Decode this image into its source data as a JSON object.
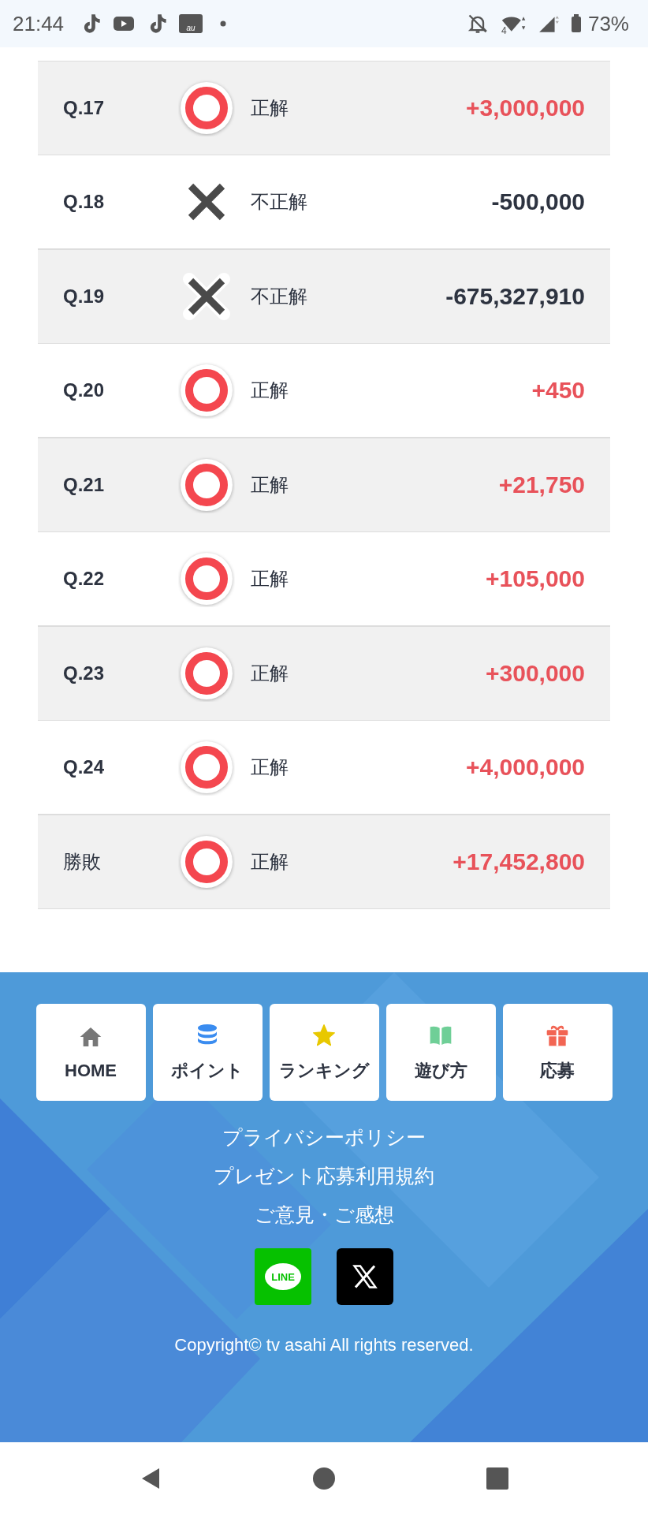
{
  "status_bar": {
    "time": "21:44",
    "mail_badge": "au",
    "network": "4",
    "battery": "73%"
  },
  "results": [
    {
      "kind": "question",
      "label": "Q.17",
      "correct": true,
      "verdict": "正解",
      "amount": "+3,000,000"
    },
    {
      "kind": "question",
      "label": "Q.18",
      "correct": false,
      "verdict": "不正解",
      "amount": "-500,000"
    },
    {
      "kind": "question",
      "label": "Q.19",
      "correct": false,
      "verdict": "不正解",
      "amount": "-675,327,910"
    },
    {
      "kind": "question",
      "label": "Q.20",
      "correct": true,
      "verdict": "正解",
      "amount": "+450"
    },
    {
      "kind": "question",
      "label": "Q.21",
      "correct": true,
      "verdict": "正解",
      "amount": "+21,750"
    },
    {
      "kind": "question",
      "label": "Q.22",
      "correct": true,
      "verdict": "正解",
      "amount": "+105,000"
    },
    {
      "kind": "question",
      "label": "Q.23",
      "correct": true,
      "verdict": "正解",
      "amount": "+300,000"
    },
    {
      "kind": "question",
      "label": "Q.24",
      "correct": true,
      "verdict": "正解",
      "amount": "+4,000,000"
    },
    {
      "kind": "total",
      "label": "勝敗",
      "correct": true,
      "verdict": "正解",
      "amount": "+17,452,800"
    }
  ],
  "footer": {
    "menu": [
      {
        "kind": "home",
        "label": "HOME"
      },
      {
        "kind": "points",
        "label": "ポイント"
      },
      {
        "kind": "ranking",
        "label": "ランキング"
      },
      {
        "kind": "howto",
        "label": "遊び方"
      },
      {
        "kind": "entry",
        "label": "応募"
      }
    ],
    "links": [
      "プライバシーポリシー",
      "プレゼント応募利用規約",
      "ご意見・ご感想"
    ],
    "social": [
      {
        "kind": "line",
        "label": "LINE"
      },
      {
        "kind": "x"
      }
    ],
    "copyright": "Copyright© tv asahi All rights reserved."
  }
}
